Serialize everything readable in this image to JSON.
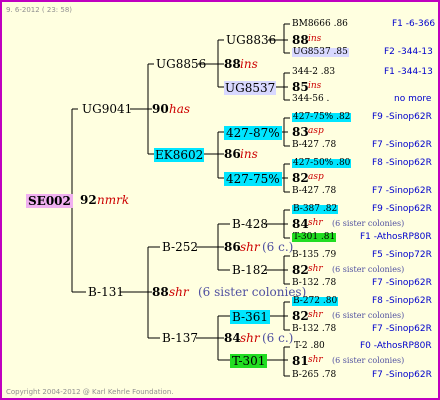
{
  "header": {
    "date": "9.  6-2012 ( 23: 58)"
  },
  "footer": {
    "copyright": "Copyright 2004-2012 @ Karl Kehrle Foundation."
  },
  "root": {
    "id": "SE002",
    "year": "92",
    "breed": "nmrk"
  },
  "gen2": {
    "sire": {
      "id": "UG9041",
      "year": "90",
      "breed": "has"
    },
    "dam": {
      "id": "B-131",
      "year": "88",
      "breed": "shr",
      "sisters": "(6 sister colonies)"
    }
  },
  "gen3": {
    "a": {
      "id": "UG8856",
      "year": "88",
      "breed": "ins"
    },
    "b": {
      "id": "EK8602",
      "year": "86",
      "breed": "ins"
    },
    "c": {
      "id": "B-252",
      "year": "86",
      "breed": "shr",
      "sisters": "(6 c.)"
    },
    "d": {
      "id": "B-137",
      "year": "84",
      "breed": "shr",
      "sisters": "(6 c.)"
    }
  },
  "gen4": [
    {
      "id": "UG8836"
    },
    {
      "id": "UG8537"
    },
    {
      "id": "427-87%"
    },
    {
      "id": "427-75%"
    },
    {
      "id": "B-428"
    },
    {
      "id": "B-182"
    },
    {
      "id": "B-361"
    },
    {
      "id": "T-301"
    }
  ],
  "gen5": [
    {
      "sire": "BM8666 .86",
      "code_a": "F1 -6-366",
      "year": "88",
      "breed": "ins",
      "dam": "UG8537 .85",
      "code_b": "F2 -344-13"
    },
    {
      "sire": "344-2 .83",
      "code_a": "F1 -344-13",
      "year": "85",
      "breed": "ins",
      "dam": "344-56 .",
      "code_b": "no more"
    },
    {
      "sire": "427-75% .82",
      "code_a": "F9 -Sinop62R",
      "year": "83",
      "breed": "asp",
      "dam": "B-427 .78",
      "code_b": "F7 -Sinop62R"
    },
    {
      "sire": "427-50% .80",
      "code_a": "F8 -Sinop62R",
      "year": "82",
      "breed": "asp",
      "dam": "B-427 .78",
      "code_b": "F7 -Sinop62R"
    },
    {
      "sire": "B-387 .82",
      "code_a": "F9 -Sinop62R",
      "year": "84",
      "breed": "shr",
      "sisters": "(6 sister colonies)",
      "dam": "T-301 .81",
      "code_b": "F1 -AthosRP80R"
    },
    {
      "sire": "B-135 .79",
      "code_a": "F5 -Sinop72R",
      "year": "82",
      "breed": "shr",
      "sisters": "(6 sister colonies)",
      "dam": "B-132 .78",
      "code_b": "F7 -Sinop62R"
    },
    {
      "sire": "B-272 .80",
      "code_a": "F8 -Sinop62R",
      "year": "82",
      "breed": "shr",
      "sisters": "(6 sister colonies)",
      "dam": "B-132 .78",
      "code_b": "F7 -Sinop62R"
    },
    {
      "sire": "T-2 .80",
      "code_a": "F0 -AthosRP80R",
      "year": "81",
      "breed": "shr",
      "sisters": "(6 sister colonies)",
      "dam": "B-265 .78",
      "code_b": "F7 -Sinop62R"
    }
  ]
}
